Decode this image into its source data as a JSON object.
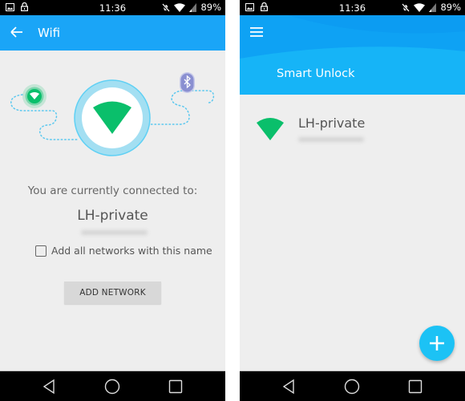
{
  "statusbar": {
    "time": "11:36",
    "battery": "89%",
    "left_icons": [
      "image-notification-icon",
      "lock-icon"
    ],
    "right_icons": [
      "vibrate-off-icon",
      "wifi-signal-icon",
      "cell-signal-icon"
    ]
  },
  "left_screen": {
    "appbar": {
      "back_icon": "arrow-left-icon",
      "title": "Wifi"
    },
    "illustration": {
      "icons": [
        "wifi-small-icon",
        "wifi-large-icon",
        "bluetooth-icon"
      ]
    },
    "connected_text": "You are currently connected to:",
    "network_name": "LH-private",
    "checkbox": {
      "label": "Add all networks with this name",
      "checked": false
    },
    "add_network_button": "ADD NETWORK"
  },
  "right_screen": {
    "header": {
      "menu_icon": "hamburger-menu-icon",
      "title": "Smart Unlock"
    },
    "list": [
      {
        "name": "LH-private",
        "icon": "wifi-icon"
      }
    ],
    "fab_icon": "plus-icon"
  },
  "navbar": {
    "icons": [
      "back-triangle-icon",
      "home-circle-icon",
      "recents-square-icon"
    ]
  },
  "colors": {
    "appbar_blue": "#1aa5f7",
    "header_blue": "#16b4f7",
    "wifi_green": "#0abf6b",
    "bluetooth_purple": "#8a8fd1",
    "fab_blue": "#1cc2f5",
    "background": "#eeeeee"
  }
}
